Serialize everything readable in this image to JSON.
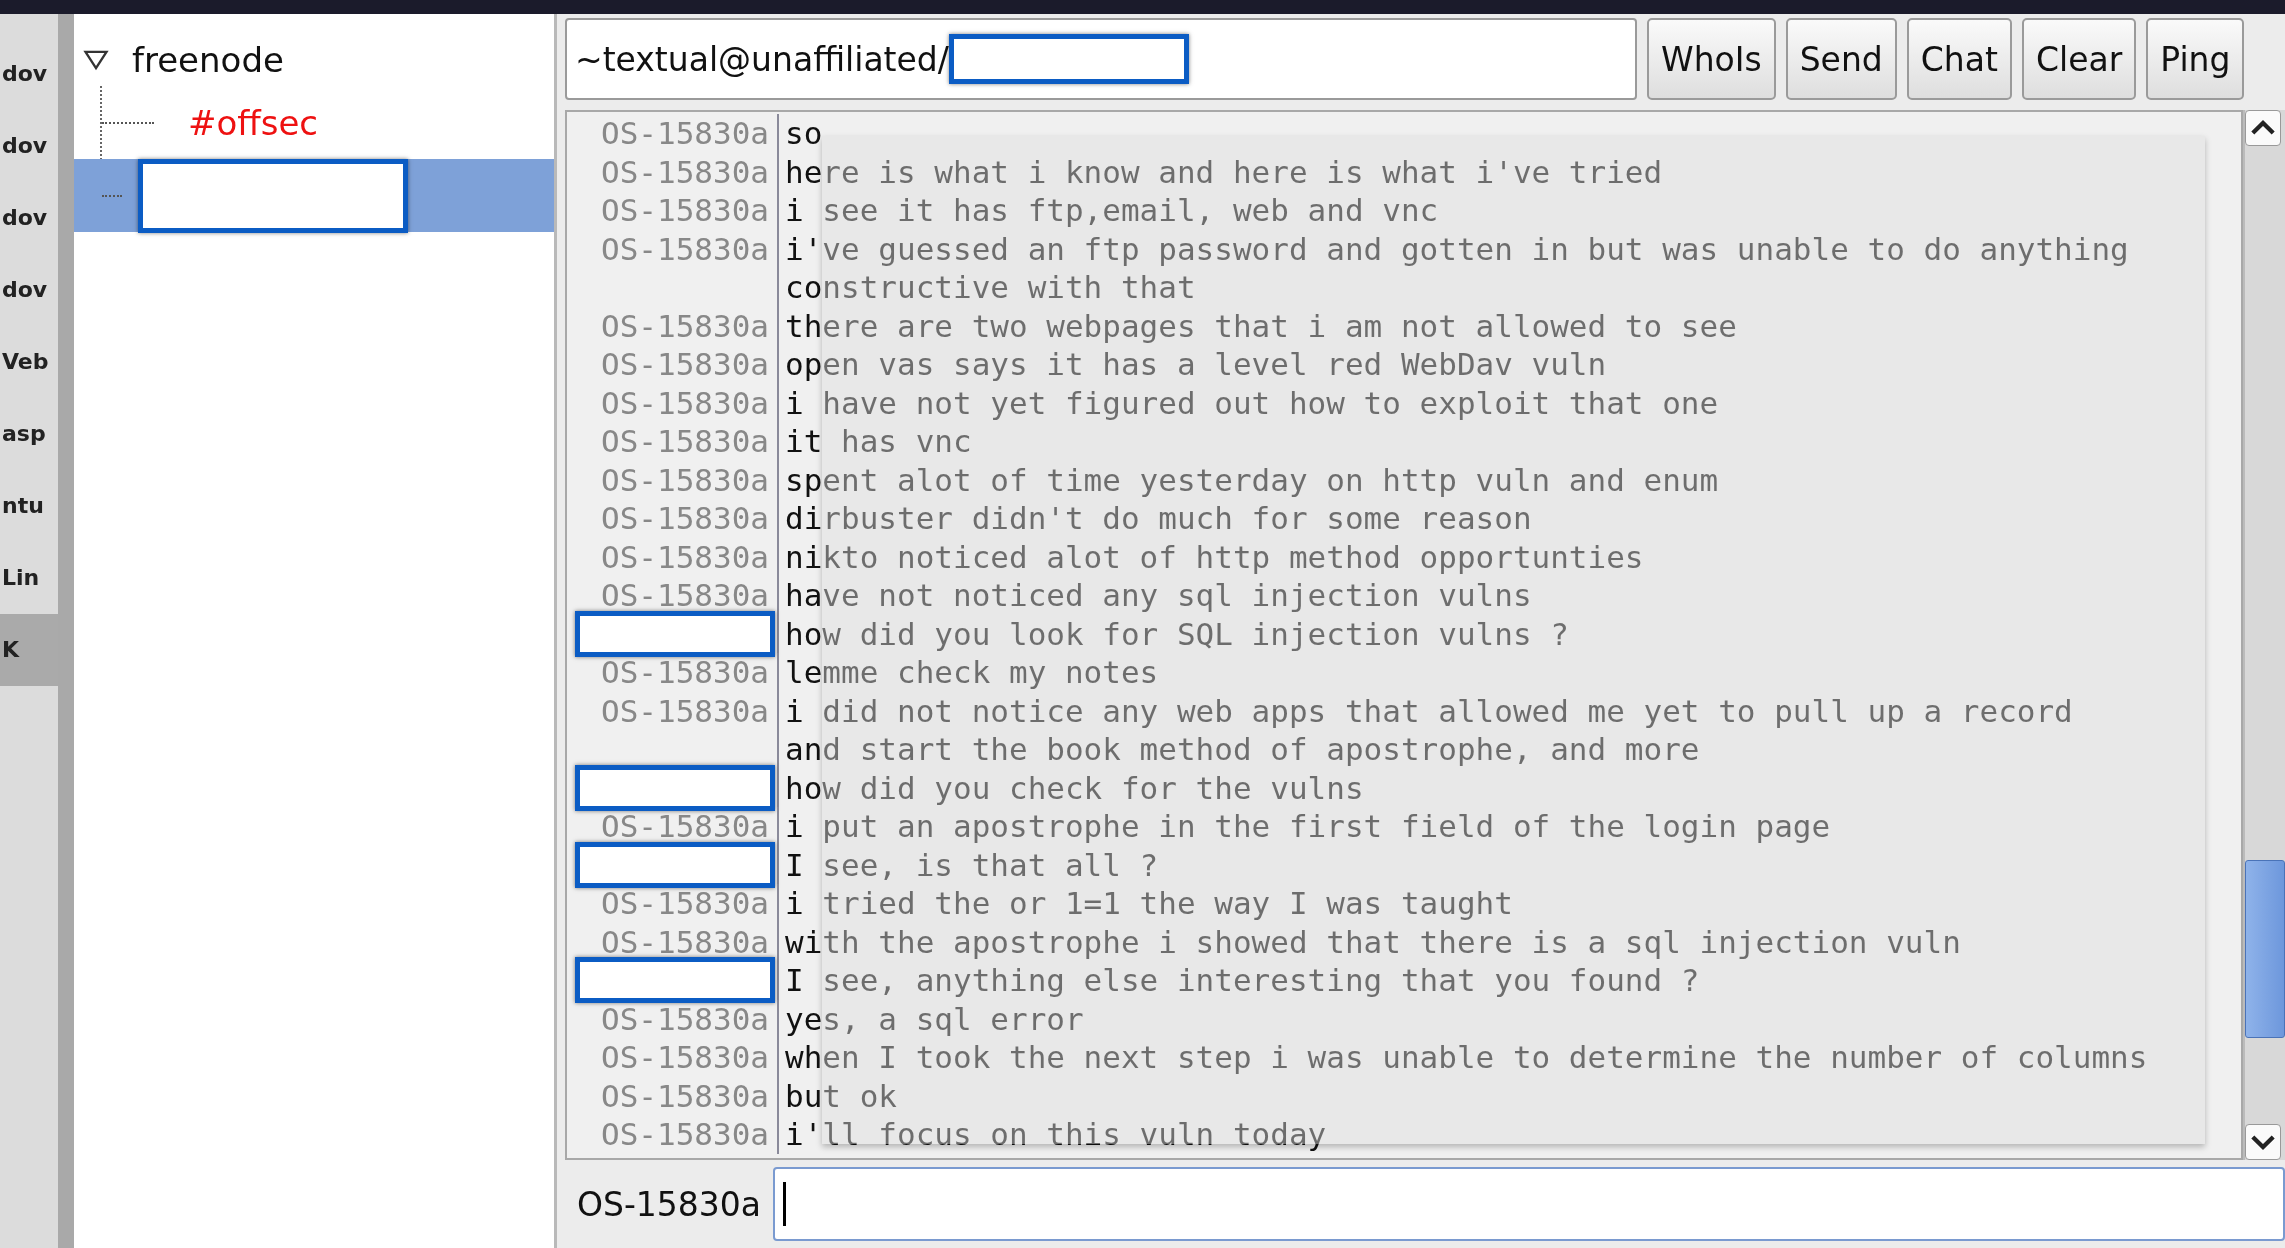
{
  "left_window_items": [
    {
      "label": "dov",
      "selected": false
    },
    {
      "label": "dov",
      "selected": false
    },
    {
      "label": "dov",
      "selected": false
    },
    {
      "label": "dov",
      "selected": false
    },
    {
      "label": "Veb",
      "selected": false
    },
    {
      "label": "asp",
      "selected": false
    },
    {
      "label": "ntu",
      "selected": false
    },
    {
      "label": "Lin",
      "selected": false
    },
    {
      "label": "K",
      "selected": true
    }
  ],
  "sidebar": {
    "tree": [
      {
        "label": "freenode",
        "expanded": true,
        "children": [
          {
            "kind": "channel",
            "label": "#offsec",
            "highlighted": true,
            "selected": false
          },
          {
            "kind": "redacted",
            "selected": true
          }
        ]
      }
    ]
  },
  "topic": {
    "text": "~textual@unaffiliated/",
    "redacted": true
  },
  "buttons": [
    "WhoIs",
    "Send",
    "Chat",
    "Clear",
    "Ping"
  ],
  "messages": [
    {
      "nick": "OS-15830a",
      "nick_redacted": false,
      "text": "so"
    },
    {
      "nick": "OS-15830a",
      "nick_redacted": false,
      "text": "here is what i know and here is what i've tried"
    },
    {
      "nick": "OS-15830a",
      "nick_redacted": false,
      "text": "i see it has ftp,email, web and vnc"
    },
    {
      "nick": "OS-15830a",
      "nick_redacted": false,
      "text": "i've guessed an ftp password and gotten in but was unable to do anything"
    },
    {
      "nick_redacted": false,
      "text": "constructive with that"
    },
    {
      "nick": "OS-15830a",
      "nick_redacted": false,
      "text": "there are two webpages that i am not allowed to see"
    },
    {
      "nick": "OS-15830a",
      "nick_redacted": false,
      "text": "open vas says it has a level red WebDav vuln"
    },
    {
      "nick": "OS-15830a",
      "nick_redacted": false,
      "text": "i have not yet figured out how to exploit that one"
    },
    {
      "nick": "OS-15830a",
      "nick_redacted": false,
      "text": "it has vnc"
    },
    {
      "nick": "OS-15830a",
      "nick_redacted": false,
      "text": "spent alot of time yesterday on http vuln and enum"
    },
    {
      "nick": "OS-15830a",
      "nick_redacted": false,
      "text": "dirbuster didn't do much for some reason"
    },
    {
      "nick": "OS-15830a",
      "nick_redacted": false,
      "text": "nikto noticed alot of http method opportunties"
    },
    {
      "nick": "OS-15830a",
      "nick_redacted": false,
      "text": "have not noticed any sql injection vulns"
    },
    {
      "nick_redacted": true,
      "text": "how did you look for SQL injection vulns ?"
    },
    {
      "nick": "OS-15830a",
      "nick_redacted": false,
      "text": "lemme check my notes"
    },
    {
      "nick": "OS-15830a",
      "nick_redacted": false,
      "text": "i did not notice any web apps that allowed me yet to pull up a record"
    },
    {
      "nick_redacted": false,
      "text": "and start the book method of apostrophe, and more"
    },
    {
      "nick_redacted": true,
      "text": "how did you check for the vulns"
    },
    {
      "nick": "OS-15830a",
      "nick_redacted": false,
      "text": "i put an apostrophe in the first field of the login page"
    },
    {
      "nick_redacted": true,
      "text": "I see, is that all ?"
    },
    {
      "nick": "OS-15830a",
      "nick_redacted": false,
      "text": "i tried the or 1=1 the way I was taught"
    },
    {
      "nick": "OS-15830a",
      "nick_redacted": false,
      "text": "with the apostrophe i showed that there is a sql injection vuln"
    },
    {
      "nick_redacted": true,
      "text": "I see, anything else interesting that you found ?"
    },
    {
      "nick": "OS-15830a",
      "nick_redacted": false,
      "text": "yes, a sql error"
    },
    {
      "nick": "OS-15830a",
      "nick_redacted": false,
      "text": "when I took the next step i was unable to determine the number of columns"
    },
    {
      "nick": "OS-15830a",
      "nick_redacted": false,
      "text": "but ok"
    },
    {
      "nick": "OS-15830a",
      "nick_redacted": false,
      "text": "i'll focus on this vuln today"
    }
  ],
  "input": {
    "nick": "OS-15830a"
  }
}
